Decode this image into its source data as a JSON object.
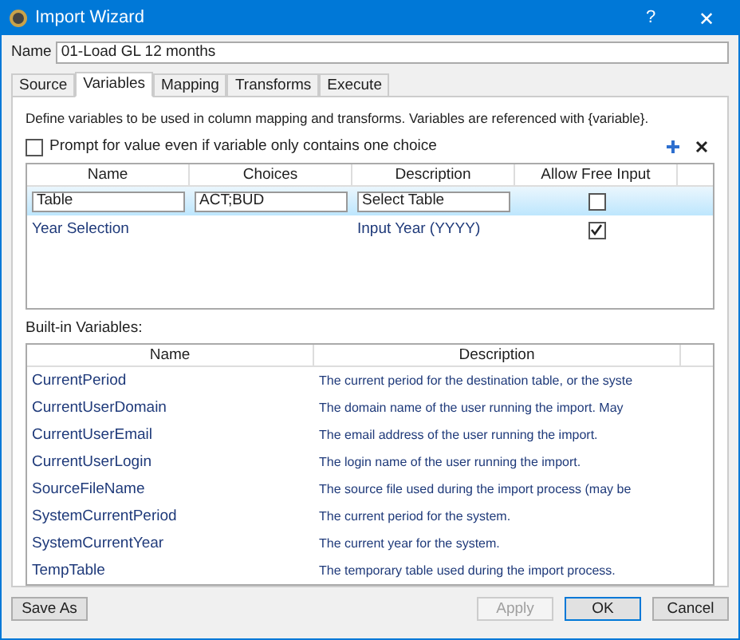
{
  "window": {
    "title": "Import Wizard",
    "help": "?",
    "close": "✕"
  },
  "name_field": {
    "label": "Name",
    "value": "01-Load GL 12 months"
  },
  "tabs": [
    {
      "label": "Source",
      "selected": false
    },
    {
      "label": "Variables",
      "selected": true
    },
    {
      "label": "Mapping",
      "selected": false
    },
    {
      "label": "Transforms",
      "selected": false
    },
    {
      "label": "Execute",
      "selected": false
    }
  ],
  "intro": "Define variables to be used in column mapping and transforms. Variables are referenced with {variable}.",
  "prompt_option": {
    "label": "Prompt for value even if variable only contains one choice",
    "checked": false
  },
  "variables_table": {
    "columns": [
      "Name",
      "Choices",
      "Description",
      "Allow Free Input"
    ],
    "rows": [
      {
        "name": "Table",
        "choices": "ACT;BUD",
        "description": "Select Table",
        "allow_free_input": false,
        "selected": true
      },
      {
        "name": "Year Selection",
        "description": "Input Year (YYYY)",
        "allow_free_input": true,
        "selected": false
      }
    ]
  },
  "builtin_label": "Built-in Variables:",
  "builtin_table": {
    "columns": [
      "Name",
      "Description"
    ],
    "rows": [
      {
        "name": "CurrentPeriod",
        "description": "The current period for the destination table, or the syste"
      },
      {
        "name": "CurrentUserDomain",
        "description": "The domain name of the user running the import. May"
      },
      {
        "name": "CurrentUserEmail",
        "description": "The email address of the user running the import."
      },
      {
        "name": "CurrentUserLogin",
        "description": "The login name of the user running the import."
      },
      {
        "name": "SourceFileName",
        "description": "The source file used during the import process (may be"
      },
      {
        "name": "SystemCurrentPeriod",
        "description": "The current period for the system."
      },
      {
        "name": "SystemCurrentYear",
        "description": "The current year for the system."
      },
      {
        "name": "TempTable",
        "description": "The temporary table used during the import process."
      }
    ]
  },
  "buttons": [
    {
      "label": "Save As",
      "disabled": false,
      "default": false
    },
    {
      "label": "Apply",
      "disabled": true,
      "default": false
    },
    {
      "label": "OK",
      "disabled": false,
      "default": true
    },
    {
      "label": "Cancel",
      "disabled": false,
      "default": false
    }
  ]
}
